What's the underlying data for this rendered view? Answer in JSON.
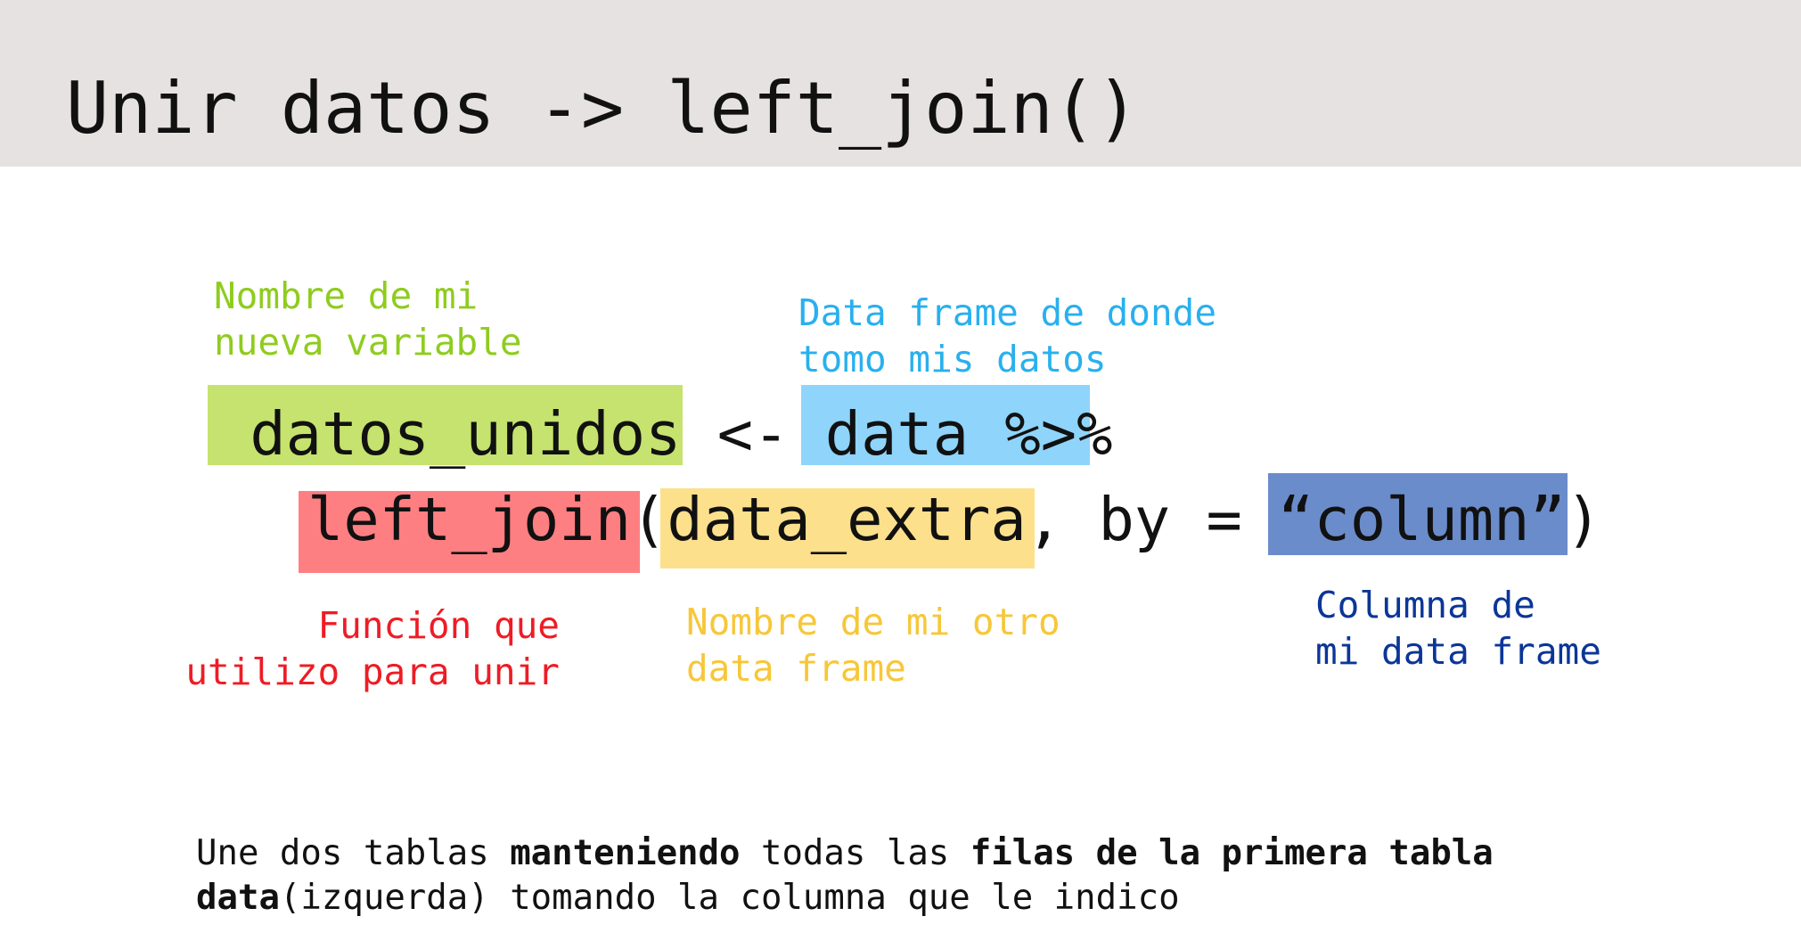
{
  "header": {
    "title": "Unir datos -> left_join()"
  },
  "colors": {
    "header_band": "#e7e2e2",
    "variable": "#c5e36e",
    "variable_text": "#8fcc1f",
    "source": "#8fd4fa",
    "source_text": "#29b0ee",
    "function": "#fe7f82",
    "function_text": "#ee1c25",
    "other_frame": "#fce08c",
    "other_frame_text": "#f7c739",
    "column": "#6b8cca",
    "column_text": "#0b3697"
  },
  "annotations": {
    "variable": [
      "Nombre de mi",
      "nueva variable"
    ],
    "source": [
      "Data frame de donde",
      "tomo mis datos"
    ],
    "function": [
      "Función que",
      "utilizo para unir"
    ],
    "other_frame": [
      "Nombre de mi otro",
      "data frame"
    ],
    "column": [
      "Columna de",
      "mi data frame"
    ]
  },
  "code": {
    "line1": {
      "var": " datos_unidos",
      "assign": " <- ",
      "data": "data %>%"
    },
    "line2": {
      "fn": "left_join",
      "open": "(",
      "arg": "data_extra",
      "by": ", by = ",
      "col": "“column”",
      "close": ")"
    }
  },
  "note": {
    "line1": {
      "a": "Une dos tablas ",
      "b": "manteniendo",
      "c": " todas las ",
      "d": "filas de la primera tabla"
    },
    "line2": {
      "a": "data",
      "b": "(izquerda) tomando la columna que le indico"
    }
  }
}
